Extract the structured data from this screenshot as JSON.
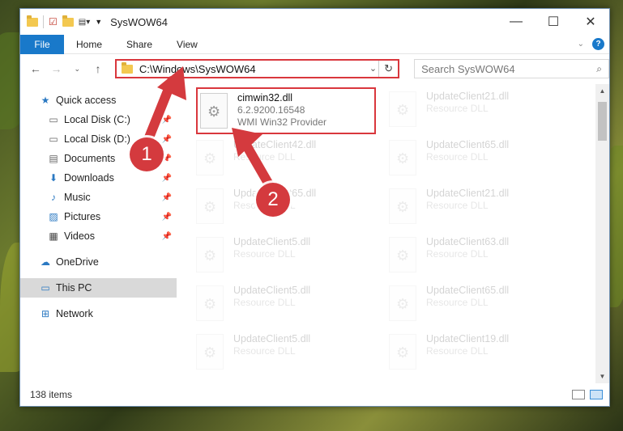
{
  "window": {
    "title": "SysWOW64",
    "controls": {
      "minimize": "—",
      "maximize": "☐",
      "close": "✕"
    }
  },
  "ribbon": {
    "file_tab": "File",
    "tabs": [
      "Home",
      "Share",
      "View"
    ]
  },
  "navbar": {
    "address": "C:\\Windows\\SysWOW64",
    "search_placeholder": "Search SysWOW64"
  },
  "sidebar": {
    "items": [
      {
        "label": "Quick access",
        "icon": "star-icon"
      },
      {
        "label": "Local Disk (C:)",
        "icon": "drive-icon",
        "pinned": true
      },
      {
        "label": "Local Disk (D:)",
        "icon": "drive-icon",
        "pinned": true
      },
      {
        "label": "Documents",
        "icon": "documents-icon",
        "pinned": true
      },
      {
        "label": "Downloads",
        "icon": "download-icon",
        "pinned": true
      },
      {
        "label": "Music",
        "icon": "music-icon",
        "pinned": true
      },
      {
        "label": "Pictures",
        "icon": "pictures-icon",
        "pinned": true
      },
      {
        "label": "Videos",
        "icon": "videos-icon",
        "pinned": true
      },
      {
        "label": "OneDrive",
        "icon": "cloud-icon"
      },
      {
        "label": "This PC",
        "icon": "computer-icon"
      },
      {
        "label": "Network",
        "icon": "network-icon"
      }
    ]
  },
  "files": [
    {
      "name": "cimwin32.dll",
      "line2": "6.2.9200.16548",
      "line3": "WMI Win32 Provider"
    },
    {
      "name": "UpdateClient21.dll",
      "line2": "Resource DLL"
    },
    {
      "name": "UpdateClient42.dll",
      "line2": "Resource DLL"
    },
    {
      "name": "UpdateClient65.dll",
      "line2": "Resource DLL"
    },
    {
      "name": "UpdateClient65.dll",
      "line2": "Resource DLL"
    },
    {
      "name": "UpdateClient21.dll",
      "line2": "Resource DLL"
    },
    {
      "name": "UpdateClient5.dll",
      "line2": "Resource DLL"
    },
    {
      "name": "UpdateClient63.dll",
      "line2": "Resource DLL"
    },
    {
      "name": "UpdateClient5.dll",
      "line2": "Resource DLL"
    },
    {
      "name": "UpdateClient65.dll",
      "line2": "Resource DLL"
    },
    {
      "name": "UpdateClient5.dll",
      "line2": "Resource DLL"
    },
    {
      "name": "UpdateClient19.dll",
      "line2": "Resource DLL"
    }
  ],
  "status": {
    "count": "138 items"
  },
  "annotations": {
    "step1": "1",
    "step2": "2"
  },
  "colors": {
    "accent": "#1979ca",
    "highlight": "#d9373d"
  }
}
